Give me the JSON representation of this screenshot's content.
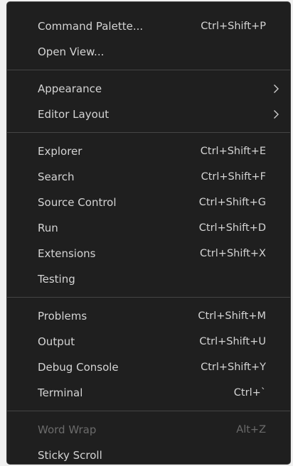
{
  "menu": {
    "groups": [
      {
        "items": [
          {
            "label": "Command Palette...",
            "shortcut": "Ctrl+Shift+P"
          },
          {
            "label": "Open View...",
            "shortcut": ""
          }
        ]
      },
      {
        "items": [
          {
            "label": "Appearance",
            "submenu_icon": "chevron-right-icon"
          },
          {
            "label": "Editor Layout",
            "submenu_icon": "chevron-right-icon"
          }
        ]
      },
      {
        "items": [
          {
            "label": "Explorer",
            "shortcut": "Ctrl+Shift+E"
          },
          {
            "label": "Search",
            "shortcut": "Ctrl+Shift+F"
          },
          {
            "label": "Source Control",
            "shortcut": "Ctrl+Shift+G"
          },
          {
            "label": "Run",
            "shortcut": "Ctrl+Shift+D"
          },
          {
            "label": "Extensions",
            "shortcut": "Ctrl+Shift+X"
          },
          {
            "label": "Testing",
            "shortcut": ""
          }
        ]
      },
      {
        "items": [
          {
            "label": "Problems",
            "shortcut": "Ctrl+Shift+M"
          },
          {
            "label": "Output",
            "shortcut": "Ctrl+Shift+U"
          },
          {
            "label": "Debug Console",
            "shortcut": "Ctrl+Shift+Y"
          },
          {
            "label": "Terminal",
            "shortcut": "Ctrl+`"
          }
        ]
      },
      {
        "items": [
          {
            "label": "Word Wrap",
            "shortcut": "Alt+Z",
            "disabled": true
          },
          {
            "label": "Sticky Scroll",
            "shortcut": ""
          }
        ]
      }
    ]
  },
  "colors": {
    "menu_background": "#1f1f1f",
    "text": "#d4d4d4",
    "disabled_text": "#6b6b6b",
    "separator": "#454545"
  }
}
